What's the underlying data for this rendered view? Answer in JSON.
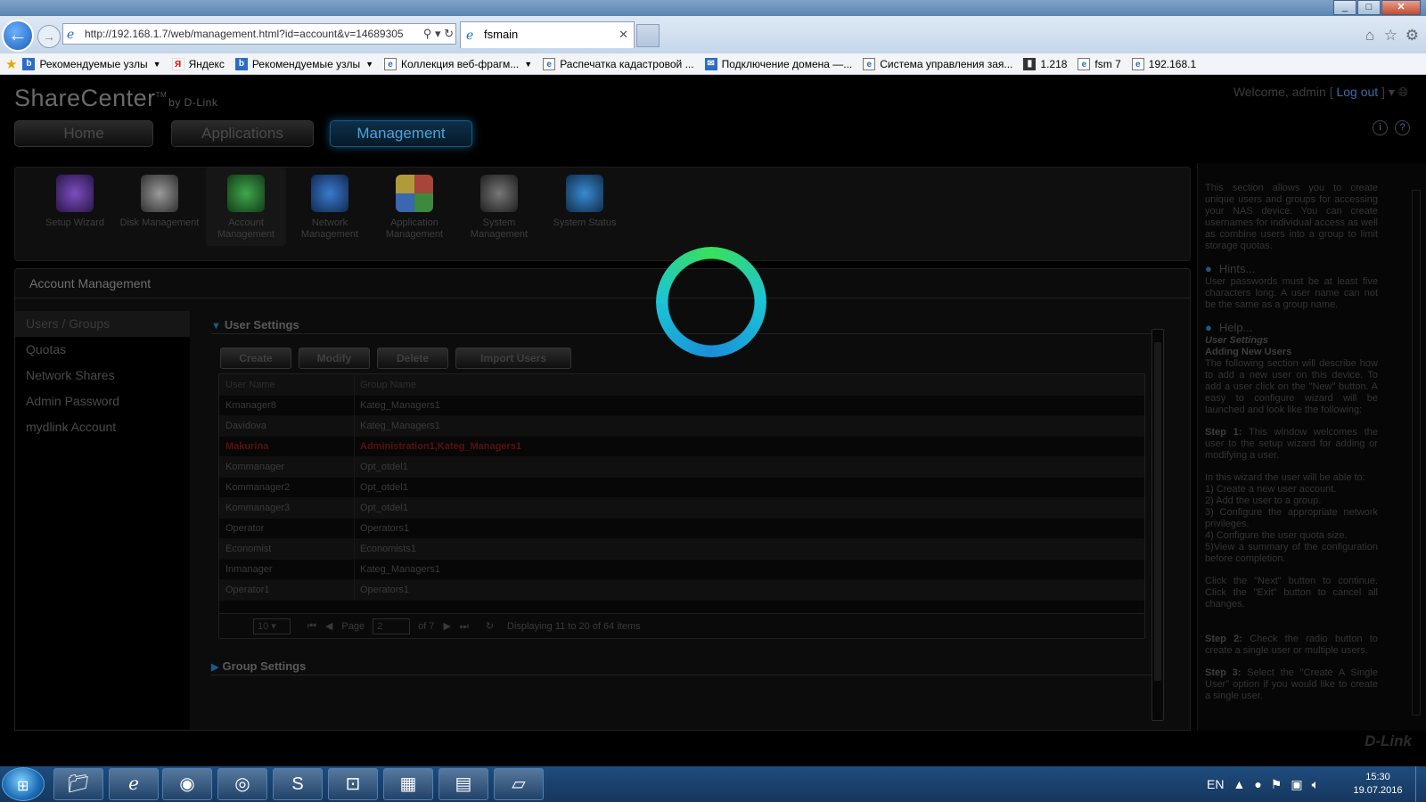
{
  "browser": {
    "address": "http://192.168.1.7/web/management.html?id=account&v=14689305",
    "tab_title": "fsmain",
    "favorites": [
      {
        "label": "Рекомендуемые узлы",
        "icon": "bing-icon",
        "dropdown": true
      },
      {
        "label": "Яндекс",
        "icon": "yandex-icon",
        "dropdown": false
      },
      {
        "label": "Рекомендуемые узлы",
        "icon": "bing-icon",
        "dropdown": true
      },
      {
        "label": "Коллекция веб-фрагм...",
        "icon": "page-icon",
        "dropdown": true
      },
      {
        "label": "Распечатка кадастровой ...",
        "icon": "page-icon",
        "dropdown": false
      },
      {
        "label": "Подключение домена —...",
        "icon": "mail-icon",
        "dropdown": false
      },
      {
        "label": "Система управления зая...",
        "icon": "page-icon",
        "dropdown": false
      },
      {
        "label": "1.218",
        "icon": "server-icon",
        "dropdown": false
      },
      {
        "label": "fsm 7",
        "icon": "page-icon",
        "dropdown": false
      },
      {
        "label": "192.168.1",
        "icon": "page-icon",
        "dropdown": false
      }
    ]
  },
  "app": {
    "logo": "ShareCenter",
    "logo_tm": "TM",
    "logo_by": "by D-Link",
    "welcome": "Welcome, admin [",
    "logout": "Log out",
    "welcome_end": "]",
    "tabs": [
      "Home",
      "Applications",
      "Management"
    ],
    "active_tab": "Management",
    "modules": [
      {
        "label": "Setup Wizard",
        "icon": "wizard-icon",
        "color": "#6a3fa0"
      },
      {
        "label": "Disk Management",
        "icon": "disk-icon",
        "color": "#7a7a7a"
      },
      {
        "label": "Account Management",
        "icon": "account-icon",
        "color": "#2e8b3a"
      },
      {
        "label": "Network Management",
        "icon": "network-icon",
        "color": "#2b66b0"
      },
      {
        "label": "Application Management",
        "icon": "application-icon",
        "color": "#a8443a"
      },
      {
        "label": "System Management",
        "icon": "system-icon",
        "color": "#5a5a5a"
      },
      {
        "label": "System Status",
        "icon": "info-icon",
        "color": "#2b7ab8"
      }
    ],
    "section_title": "Account Management",
    "subnav": [
      "Users / Groups",
      "Quotas",
      "Network Shares",
      "Admin Password",
      "mydlink Account"
    ],
    "user_settings_title": "User Settings",
    "buttons": [
      "Create",
      "Modify",
      "Delete",
      "Import Users"
    ],
    "columns": [
      "User Name",
      "Group Name"
    ],
    "rows": [
      {
        "user": "Kmanager8",
        "group": "Kateg_Managers1"
      },
      {
        "user": "Davidova",
        "group": "Kateg_Managers1"
      },
      {
        "user": "Makurina",
        "group": "Administration1,Kateg_Managers1",
        "highlight": true
      },
      {
        "user": "Kommanager",
        "group": "Opt_otdel1"
      },
      {
        "user": "Kommanager2",
        "group": "Opt_otdel1"
      },
      {
        "user": "Kommanager3",
        "group": "Opt_otdel1"
      },
      {
        "user": "Operator",
        "group": "Operators1"
      },
      {
        "user": "Economist",
        "group": "Economists1"
      },
      {
        "user": "Inmanager",
        "group": "Kateg_Managers1"
      },
      {
        "user": "Operator1",
        "group": "Operators1"
      }
    ],
    "pager": {
      "page_size": "10",
      "page_label": "Page",
      "page": "2",
      "of": "of 7",
      "display": "Displaying 11 to 20 of 64 items"
    },
    "group_settings_title": "Group Settings",
    "brand": "D-Link"
  },
  "help": {
    "intro": "This section allows you to create unique users and groups for accessing your NAS device. You can create usernames for individual access as well as combine users into a group to limit storage quotas.",
    "hints_title": "Hints...",
    "hints": "User passwords must be at least five characters long. A user name can not be the same as a group name.",
    "help_title": "Help...",
    "user_settings": "User Settings",
    "adding_users": "Adding New Users",
    "adding_text": "The following section will describe how to add a new user on this device. To add a user click on the \"New\" button. A easy to configure wizard will be launched and look like the following:",
    "step1_label": "Step 1:",
    "step1": "This window welcomes the user to the setup wizard for adding or modifying a user.",
    "wizard_intro": "In this wizard the user will be able to:",
    "wizard_items": [
      "1) Create a new user account.",
      "2) Add the user to a group.",
      "3) Configure the appropriate network privileges.",
      "4) Configure the user quota size.",
      "5)View a summary of the configuration before completion."
    ],
    "next_text": "Click the \"Next\" button to continue. Click the \"Exit\" button to cancel all changes.",
    "step2_label": "Step 2:",
    "step2": "Check the radio button to create a single user or multiple users.",
    "step3_label": "Step 3:",
    "step3": "Select the \"Create A Single User\" option if you would like to create a single user."
  },
  "taskbar": {
    "apps": [
      "explorer-icon",
      "ie-icon",
      "firefox-icon",
      "chrome-icon",
      "skype-icon",
      "network-app-icon",
      "calculator-icon",
      "document-icon",
      "notepad-icon"
    ],
    "lang": "EN",
    "time": "15:30",
    "date": "19.07.2016"
  }
}
